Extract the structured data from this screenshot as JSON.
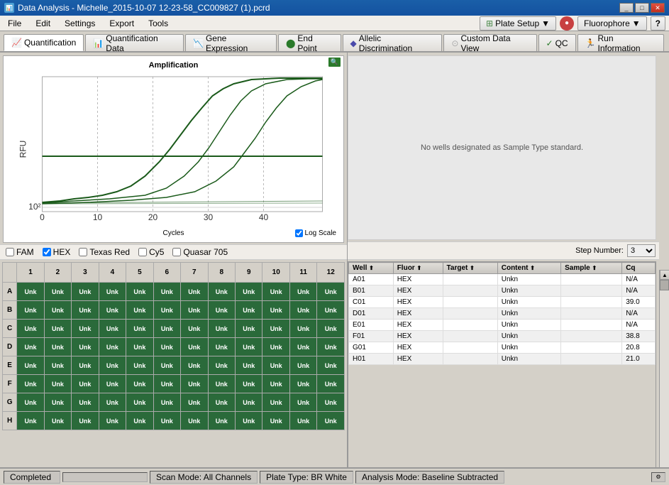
{
  "window": {
    "title": "Data Analysis - Michelle_2015-10-07 12-23-58_CC009827 (1).pcrd"
  },
  "menu": {
    "items": [
      "File",
      "Edit",
      "Settings",
      "Export",
      "Tools"
    ]
  },
  "toolbar": {
    "plate_setup_label": "Plate Setup",
    "fluorophore_label": "Fluorophore",
    "help_label": "?"
  },
  "tabs": [
    {
      "label": "Quantification",
      "active": true,
      "icon": "chart"
    },
    {
      "label": "Quantification Data",
      "active": false,
      "icon": "table"
    },
    {
      "label": "Gene Expression",
      "active": false,
      "icon": "bar"
    },
    {
      "label": "End Point",
      "active": false,
      "icon": "dot"
    },
    {
      "label": "Allelic Discrimination",
      "active": false,
      "icon": "scatter"
    },
    {
      "label": "Custom Data View",
      "active": false,
      "icon": "grid"
    },
    {
      "label": "QC",
      "active": false,
      "icon": "check"
    },
    {
      "label": "Run Information",
      "active": false,
      "icon": "info"
    }
  ],
  "chart": {
    "title": "Amplification",
    "x_label": "Cycles",
    "y_label": "RFU",
    "log_scale_label": "Log Scale",
    "log_scale_checked": true
  },
  "fluorophores": [
    {
      "label": "FAM",
      "checked": false,
      "color": "#888"
    },
    {
      "label": "HEX",
      "checked": true,
      "color": "#2a6a2a"
    },
    {
      "label": "Texas Red",
      "checked": false,
      "color": "#888"
    },
    {
      "label": "Cy5",
      "checked": false,
      "color": "#888"
    },
    {
      "label": "Quasar 705",
      "checked": false,
      "color": "#888"
    }
  ],
  "plate": {
    "columns": [
      "1",
      "2",
      "3",
      "4",
      "5",
      "6",
      "7",
      "8",
      "9",
      "10",
      "11",
      "12"
    ],
    "rows": [
      "A",
      "B",
      "C",
      "D",
      "E",
      "F",
      "G",
      "H"
    ],
    "cells": "Unk"
  },
  "std_curve": {
    "message": "No wells designated as Sample Type standard."
  },
  "step_number": {
    "label": "Step Number:",
    "value": "3"
  },
  "data_table": {
    "columns": [
      "Well",
      "Fluor",
      "Target",
      "Content",
      "Sample",
      "Cq"
    ],
    "rows": [
      {
        "well": "A01",
        "fluor": "HEX",
        "target": "",
        "content": "Unkn",
        "sample": "",
        "cq": "N/A"
      },
      {
        "well": "B01",
        "fluor": "HEX",
        "target": "",
        "content": "Unkn",
        "sample": "",
        "cq": "N/A"
      },
      {
        "well": "C01",
        "fluor": "HEX",
        "target": "",
        "content": "Unkn",
        "sample": "",
        "cq": "39.0"
      },
      {
        "well": "D01",
        "fluor": "HEX",
        "target": "",
        "content": "Unkn",
        "sample": "",
        "cq": "N/A"
      },
      {
        "well": "E01",
        "fluor": "HEX",
        "target": "",
        "content": "Unkn",
        "sample": "",
        "cq": "N/A"
      },
      {
        "well": "F01",
        "fluor": "HEX",
        "target": "",
        "content": "Unkn",
        "sample": "",
        "cq": "38.8"
      },
      {
        "well": "G01",
        "fluor": "HEX",
        "target": "",
        "content": "Unkn",
        "sample": "",
        "cq": "20.8"
      },
      {
        "well": "H01",
        "fluor": "HEX",
        "target": "",
        "content": "Unkn",
        "sample": "",
        "cq": "21.0"
      }
    ]
  },
  "status_bar": {
    "status": "Completed",
    "scan_mode": "Scan Mode: All Channels",
    "plate_type": "Plate Type: BR White",
    "analysis_mode": "Analysis Mode: Baseline Subtracted"
  }
}
